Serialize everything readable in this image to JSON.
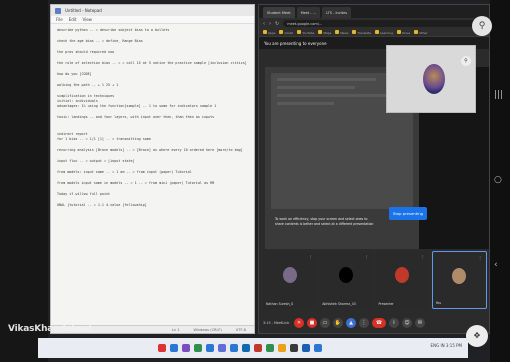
{
  "notepad": {
    "title": "Untitled - Notepad",
    "menu": [
      "File",
      "Edit",
      "View"
    ],
    "lines": [
      "describe python -- = describe subject bias to a bullets",
      "",
      "check the age bias -- = define_ Range Bias",
      "",
      "the pros should required now",
      "",
      "the role of selection bias -- = = call 15 at 5 notice the practice sample [inclusion critics]",
      "",
      "how do you [CODE]",
      "",
      "walking the path -- + 1 25 + 1",
      "",
      "simplification in techniques",
      "      initial: individuals",
      "      advantages: 1% using the function[sample] -- 1 to some for indicators sample 1",
      "",
      "      toxic: landings -- and four layers, with input over then, than then as inputs",
      "",
      "",
      "indirect report",
      "for 1 bias -- = 1/1 [1] -- = transmitting some",
      "",
      "recurring analysis [Brace models] -- = [Brace] as where every 10 ordered here [more/to bag]",
      "",
      "      input floc -- = output = [input state]",
      "",
      "      from models: input same -- = 1 am -- = from input (paper) Tutorial",
      "",
      "      from models input same in models -- = 1 -- = from mini (paper) Tutorial as RM",
      "",
      "Today if willow full point",
      "",
      "UNAL [tutorial -- = 1-1 4-value [fellowship]"
    ],
    "status": [
      "Ln 1",
      "Windows (CRLF)",
      "UTF-8"
    ]
  },
  "browser": {
    "tabs": [
      "Student Meet",
      "Meet - ...",
      "LTS - Invites"
    ],
    "url": "meet.google.com/...",
    "bookmarks": [
      "Apps",
      "Gmail",
      "YouTube",
      "Maps",
      "News",
      "Translate",
      "Learning",
      "Drive",
      "Other"
    ],
    "meet_header": "You are presenting to everyone",
    "share_caption": [
      "To work on efficiency, stop your screen and select ones to",
      "share contents is better and select at a different presentation"
    ],
    "stop_label": "Stop presenting",
    "participants": [
      {
        "name": "Nathan Suresh_S",
        "color": "#7a6a8a"
      },
      {
        "name": "Abhishek Sharma_43",
        "color": "#000000"
      },
      {
        "name": "Presenter",
        "color": "#c0392b"
      },
      {
        "name": "You",
        "color": "#b08b6a"
      }
    ],
    "meeting_time": "3:15 - MeetLink",
    "controls": [
      "mic-icon",
      "camera-icon",
      "caption-icon",
      "raise-hand-icon",
      "present-icon",
      "more-icon",
      "hangup-icon"
    ]
  },
  "watermark": "VikasKhandelwal",
  "taskbar": {
    "clock": "ENG  IN  3:15 PM"
  }
}
